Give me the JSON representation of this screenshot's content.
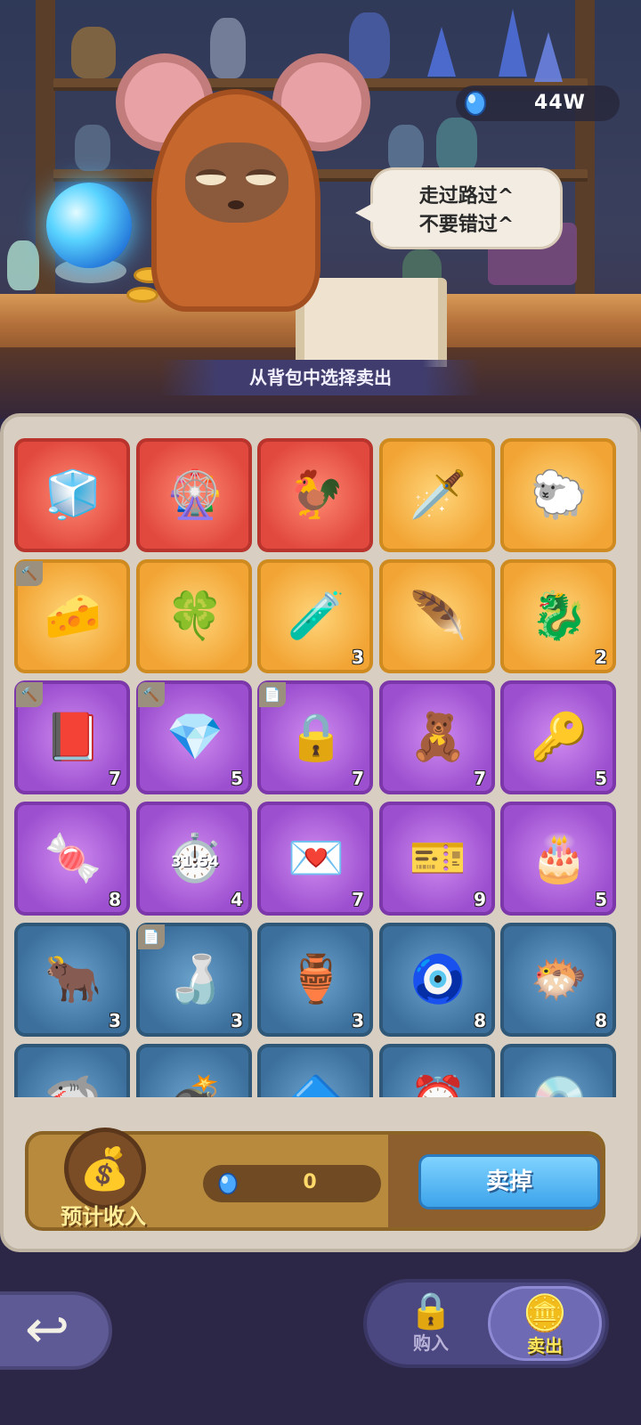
{
  "currency": {
    "total": "44W",
    "icon": "blue-gem-icon"
  },
  "dialogue": {
    "line1": "走过路过^",
    "line2": "不要错过^"
  },
  "banner": {
    "text": "从背包中选择卖出"
  },
  "items": [
    {
      "name": "ice-cube-icon",
      "glyph": "🧊",
      "rarity": "red",
      "count": ""
    },
    {
      "name": "golden-wheel-icon",
      "glyph": "🎡",
      "rarity": "red",
      "count": ""
    },
    {
      "name": "rooster-icon",
      "glyph": "🐓",
      "rarity": "red",
      "count": ""
    },
    {
      "name": "golden-dagger-icon",
      "glyph": "🗡️",
      "rarity": "gold",
      "count": ""
    },
    {
      "name": "golden-sheep-icon",
      "glyph": "🐑",
      "rarity": "gold",
      "count": ""
    },
    {
      "name": "cheese-icon",
      "glyph": "🧀",
      "rarity": "gold",
      "count": "",
      "tag": "🔨"
    },
    {
      "name": "clover-coin-icon",
      "glyph": "🍀",
      "rarity": "gold",
      "count": ""
    },
    {
      "name": "star-potion-icon",
      "glyph": "🧪",
      "rarity": "gold",
      "count": "3"
    },
    {
      "name": "golden-feather-icon",
      "glyph": "🪶",
      "rarity": "gold",
      "count": ""
    },
    {
      "name": "golden-dragon-icon",
      "glyph": "🐉",
      "rarity": "gold",
      "count": "2"
    },
    {
      "name": "red-book-icon",
      "glyph": "📕",
      "rarity": "purple",
      "count": "7",
      "tag": "🔨"
    },
    {
      "name": "blue-gem-item-icon",
      "glyph": "💎",
      "rarity": "purple",
      "count": "5",
      "tag": "🔨"
    },
    {
      "name": "chained-lock-icon",
      "glyph": "🔒",
      "rarity": "purple",
      "count": "7",
      "tag": "📄"
    },
    {
      "name": "teddy-bear-icon",
      "glyph": "🧸",
      "rarity": "purple",
      "count": "7"
    },
    {
      "name": "silver-key-icon",
      "glyph": "🔑",
      "rarity": "purple",
      "count": "5"
    },
    {
      "name": "candy-icon",
      "glyph": "🍬",
      "rarity": "purple",
      "count": "8"
    },
    {
      "name": "stopwatch-icon",
      "glyph": "⏱️",
      "rarity": "purple",
      "count": "4",
      "time": "31:54"
    },
    {
      "name": "love-letter-icon",
      "glyph": "💌",
      "rarity": "purple",
      "count": "7"
    },
    {
      "name": "vip-ticket-icon",
      "glyph": "🎫",
      "rarity": "purple",
      "count": "9"
    },
    {
      "name": "birthday-cake-icon",
      "glyph": "🎂",
      "rarity": "purple",
      "count": "5"
    },
    {
      "name": "bull-figurine-icon",
      "glyph": "🐂",
      "rarity": "blue",
      "count": "3"
    },
    {
      "name": "blue-bottle-icon",
      "glyph": "🍶",
      "rarity": "blue",
      "count": "3",
      "tag": "📄"
    },
    {
      "name": "jar-potion-icon",
      "glyph": "🏺",
      "rarity": "blue",
      "count": "3"
    },
    {
      "name": "evil-eye-charm-icon",
      "glyph": "🧿",
      "rarity": "blue",
      "count": "8"
    },
    {
      "name": "puffer-fish-icon",
      "glyph": "🐡",
      "rarity": "blue",
      "count": "8"
    },
    {
      "name": "shark-fin-icon",
      "glyph": "🦈",
      "rarity": "blue",
      "count": ""
    },
    {
      "name": "bomb-icon",
      "glyph": "💣",
      "rarity": "blue",
      "count": ""
    },
    {
      "name": "crystal-shard-icon",
      "glyph": "🔷",
      "rarity": "blue",
      "count": ""
    },
    {
      "name": "alarm-clock-icon",
      "glyph": "⏰",
      "rarity": "blue",
      "count": ""
    },
    {
      "name": "disc-icon",
      "glyph": "💿",
      "rarity": "blue",
      "count": ""
    }
  ],
  "sell_panel": {
    "estimate_label": "预计收入",
    "income_value": "0",
    "sell_button": "卖掉",
    "bag_icon": "money-bag-icon"
  },
  "nav": {
    "back_icon": "back-arrow-icon",
    "buy_label": "购入",
    "sell_label": "卖出"
  },
  "colors": {
    "red": "#e1483e",
    "gold": "#f2a535",
    "purple": "#9c4fcf",
    "blue": "#3c6f9c",
    "accent_button": "#3da3ea"
  }
}
